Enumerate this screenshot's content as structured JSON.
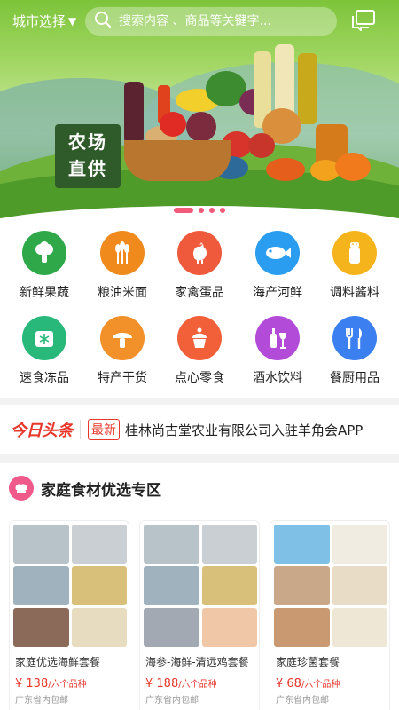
{
  "header": {
    "city_label": "城市选择",
    "search_placeholder": "搜索内容 、商品等关键字...",
    "message_icon": "message-icon"
  },
  "banner": {
    "sign_line1": "农场",
    "sign_line2": "直供",
    "slides": 4,
    "active_slide": 1
  },
  "categories": [
    {
      "label": "新鲜果蔬",
      "color": "#2fa84a",
      "icon": "vegetable-icon"
    },
    {
      "label": "粮油米面",
      "color": "#f08a1c",
      "icon": "grain-icon"
    },
    {
      "label": "家禽蛋品",
      "color": "#f05a3c",
      "icon": "rooster-icon"
    },
    {
      "label": "海产河鲜",
      "color": "#2a9df0",
      "icon": "fish-icon"
    },
    {
      "label": "调料酱料",
      "color": "#f5b31c",
      "icon": "seasoning-icon"
    },
    {
      "label": "速食冻品",
      "color": "#27b87a",
      "icon": "frozen-food-icon"
    },
    {
      "label": "特产干货",
      "color": "#f2902a",
      "icon": "mushroom-icon"
    },
    {
      "label": "点心零食",
      "color": "#f2603a",
      "icon": "cupcake-icon"
    },
    {
      "label": "酒水饮料",
      "color": "#b24bd8",
      "icon": "wine-icon"
    },
    {
      "label": "餐厨用品",
      "color": "#3b7ff0",
      "icon": "cutlery-icon"
    }
  ],
  "headlines": {
    "brand": "今日头条",
    "tag": "最新",
    "text": "桂林尚古堂农业有限公司入驻羊角会APP"
  },
  "featured": {
    "title": "家庭食材优选专区",
    "icon": "chef-icon",
    "products": [
      {
        "name": "家庭优选海鲜套餐",
        "price": "¥ 138",
        "unit": "/六个品种",
        "shipping": "广东省内包邮",
        "tiles": [
          "#b7c3c9",
          "#c9cfd2",
          "#9fb2bd",
          "#d9c07a",
          "#8c6a5a",
          "#e7dcc0"
        ]
      },
      {
        "name": "海参-海鲜-清远鸡套餐",
        "price": "¥ 188",
        "unit": "/六个品种",
        "shipping": "广东省内包邮",
        "tiles": [
          "#b7c3c9",
          "#c9cfd2",
          "#9fb2bd",
          "#d9c07a",
          "#a3a9b3",
          "#f0c8a8"
        ]
      },
      {
        "name": "家庭珍菌套餐",
        "price": "¥ 68",
        "unit": "/六个品种",
        "shipping": "广东省内包邮",
        "tiles": [
          "#7fc1e6",
          "#f1ece2",
          "#c8a888",
          "#e9dcc6",
          "#c99a72",
          "#efe7d6"
        ]
      }
    ]
  }
}
